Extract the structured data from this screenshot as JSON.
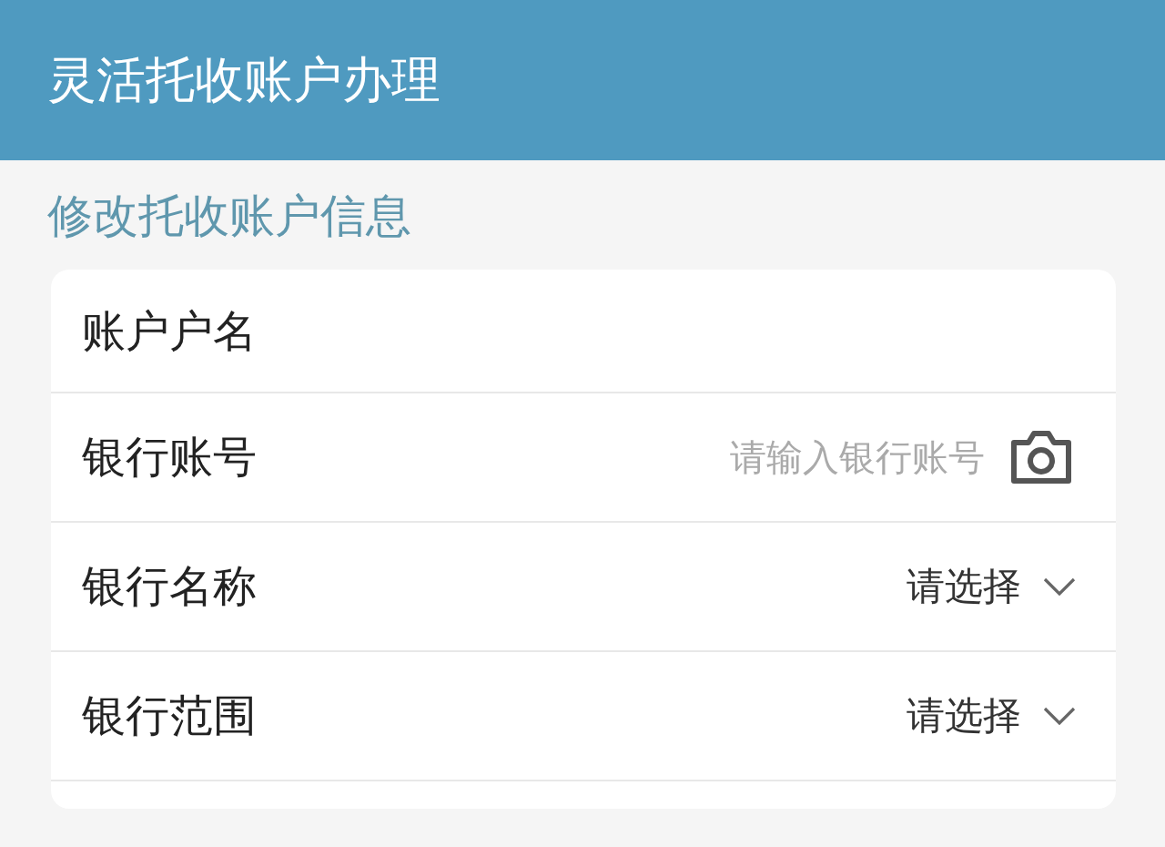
{
  "header": {
    "title": "灵活托收账户办理"
  },
  "section": {
    "title": "修改托收账户信息"
  },
  "rows": [
    {
      "kind": "text",
      "label": "账户户名"
    },
    {
      "kind": "input",
      "label": "银行账号",
      "placeholder": "请输入银行账号"
    },
    {
      "kind": "select",
      "label": "银行名称",
      "value": "请选择"
    },
    {
      "kind": "select",
      "label": "银行范围",
      "value": "请选择"
    }
  ]
}
